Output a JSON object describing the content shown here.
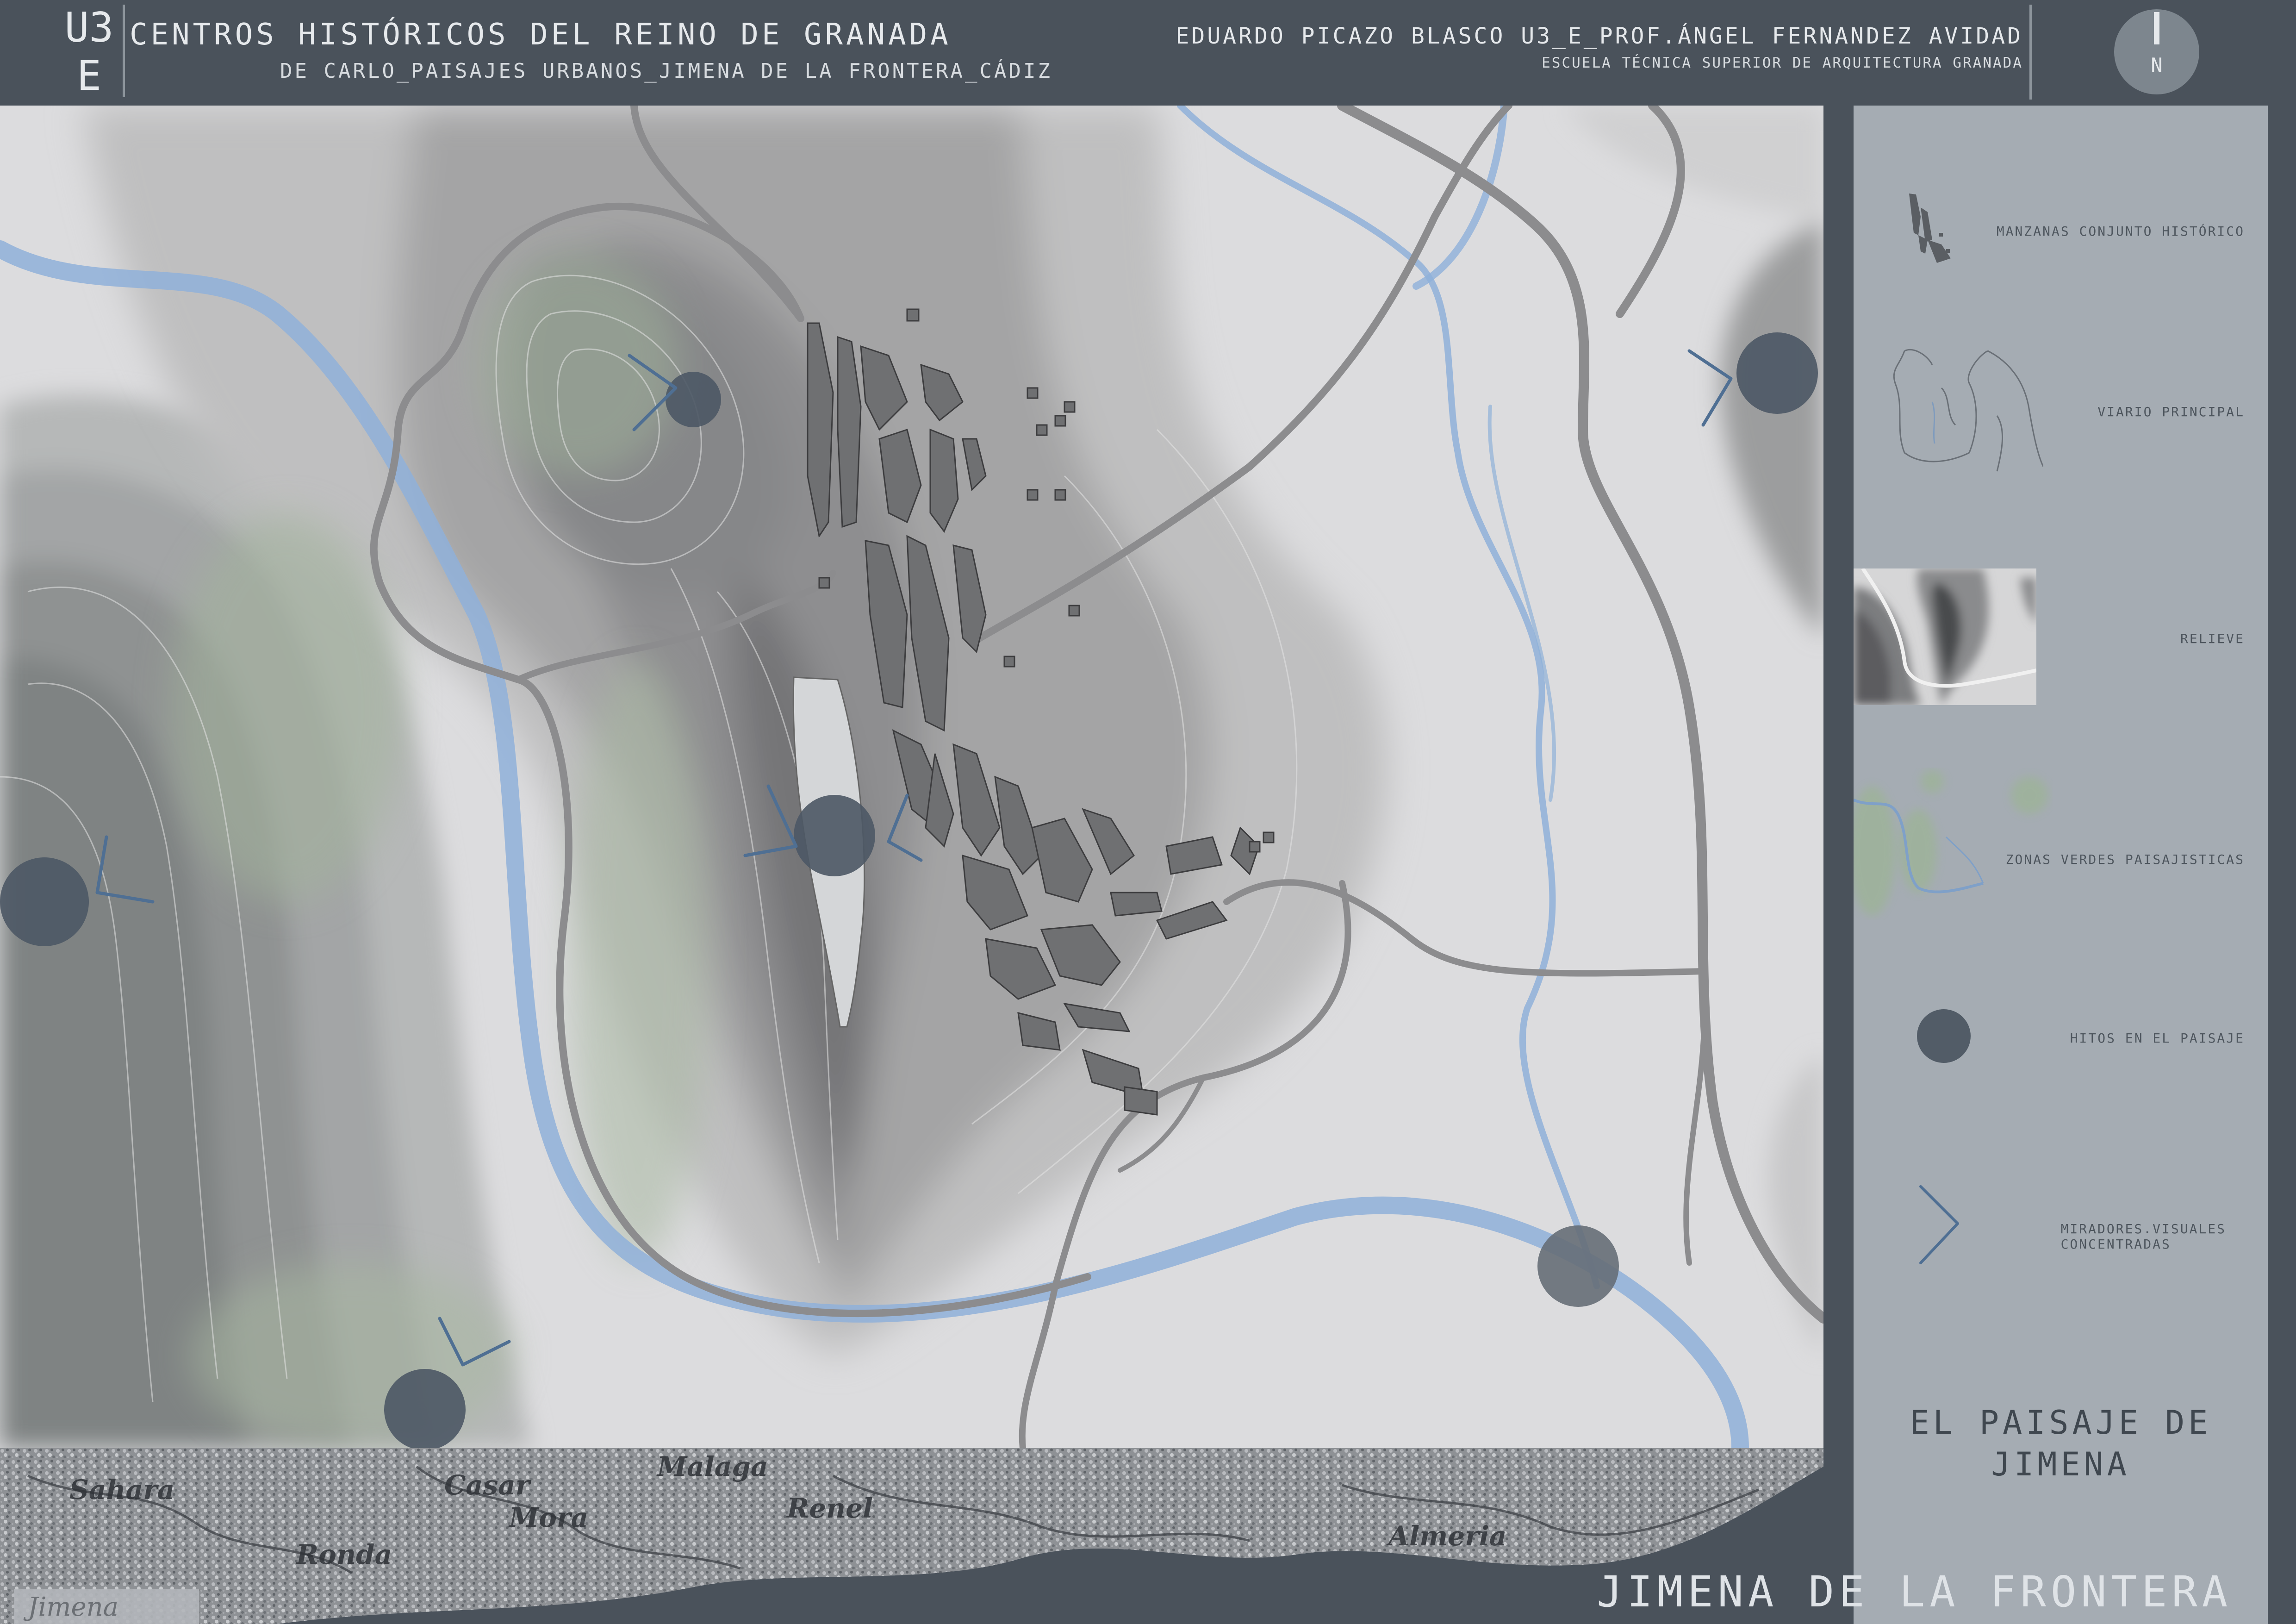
{
  "header": {
    "code_line1": "U3",
    "code_line2": "E",
    "title": "CENTROS HISTÓRICOS DEL REINO DE GRANADA",
    "subtitle": "DE CARLO_PAISAJES URBANOS_JIMENA DE LA FRONTERA_CÁDIZ",
    "author": "EDUARDO PICAZO BLASCO U3_E_PROF.ÁNGEL FERNANDEZ AVIDAD",
    "school": "ESCUELA TÉCNICA SUPERIOR DE ARQUITECTURA GRANADA",
    "north_label": "N"
  },
  "legend": {
    "items": [
      {
        "label": "MANZANAS CONJUNTO HISTÓRICO",
        "icon": "blocks-thumbnail-icon"
      },
      {
        "label": "VIARIO PRINCIPAL",
        "icon": "roads-thumbnail-icon"
      },
      {
        "label": "RELIEVE",
        "icon": "relief-thumbnail-icon"
      },
      {
        "label": "ZONAS VERDES PAISAJISTICAS",
        "icon": "green-zones-thumbnail-icon"
      },
      {
        "label": "HITOS EN EL PAISAJE",
        "icon": "landmark-circle-icon"
      },
      {
        "label": "MIRADORES.VISUALES",
        "label_line2": "CONCENTRADAS",
        "icon": "viewpoint-chevron-icon"
      }
    ],
    "panel_title_line1": "EL PAISAJE DE",
    "panel_title_line2": "JIMENA"
  },
  "old_map_words": [
    "Sahara",
    "Ronda",
    "Casar",
    "Malaga",
    "Mora",
    "Renel",
    "Almeria",
    "Jimena"
  ],
  "footer_title": "JIMENA DE LA FRONTERA",
  "colors": {
    "background": "#4a525b",
    "map_base": "#dcdcde",
    "river": "#8fb0d9",
    "road": "#8c8c8e",
    "landmark": "#4d5865",
    "viewpoint": "#4f6f93",
    "green_zone": "#a9b8a2",
    "legend_panel": "#a5acb3"
  }
}
